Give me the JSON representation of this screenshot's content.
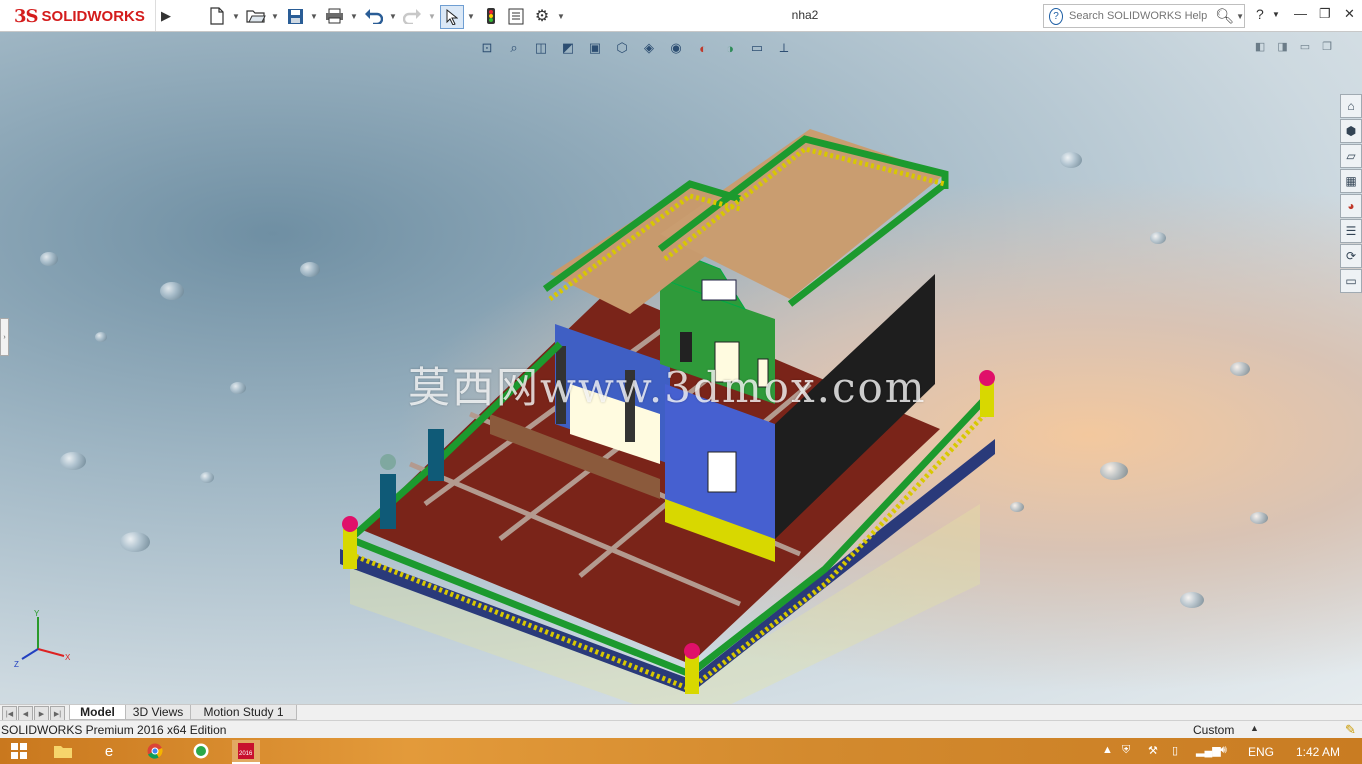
{
  "app": {
    "logo_prefix": "3S",
    "logo_text": "SOLIDWORKS",
    "document_title": "nha2"
  },
  "toolbar": {
    "icons": [
      "new-document-icon",
      "open-folder-icon",
      "save-icon",
      "print-icon",
      "undo-icon",
      "redo-icon",
      "select-arrow-icon",
      "rebuild-traffic-light-icon",
      "file-properties-icon",
      "options-gear-icon"
    ]
  },
  "search": {
    "placeholder": "Search SOLIDWORKS Help"
  },
  "window_controls": {
    "help": "?",
    "minimize": "—",
    "restore": "❐",
    "close": "✕"
  },
  "heads_up_toolbar": {
    "icons": [
      "zoom-to-fit-icon",
      "zoom-to-area-icon",
      "previous-view-icon",
      "section-view-icon",
      "dynamic-annotation-icon",
      "view-orientation-icon",
      "display-style-icon",
      "hide-show-icon",
      "edit-appearance-icon",
      "apply-scene-icon",
      "view-settings-icon",
      "reset-triad-icon"
    ]
  },
  "viewport": {
    "watermark": "莫西网www.3dmox.com",
    "triad": {
      "x": "X",
      "y": "Y",
      "z": "Z"
    }
  },
  "taskpane": {
    "icons": [
      "home-icon",
      "parts-library-icon",
      "file-explorer-icon",
      "view-palette-icon",
      "appearances-icon",
      "custom-properties-icon",
      "solidworks-forum-icon",
      "chat-icon"
    ]
  },
  "tabs": {
    "items": [
      {
        "label": "Model",
        "active": true
      },
      {
        "label": "3D Views",
        "active": false
      },
      {
        "label": "Motion Study 1",
        "active": false
      }
    ]
  },
  "status": {
    "edition": "SOLIDWORKS Premium 2016 x64 Edition",
    "units": "Custom"
  },
  "taskbar": {
    "language": "ENG",
    "time": "1:42 AM"
  },
  "colors": {
    "brand_red": "#d41c1c",
    "taskbar_orange": "#d98a2b",
    "hud_blue": "#2d4e72"
  }
}
